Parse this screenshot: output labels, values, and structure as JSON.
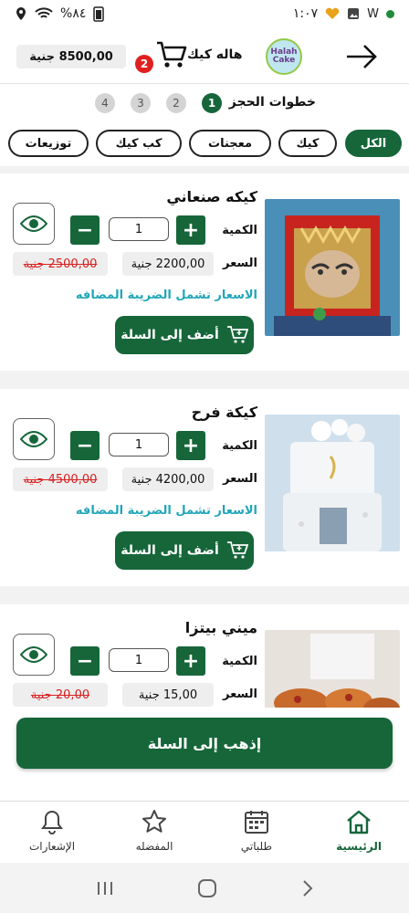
{
  "status_bar": {
    "time": "١:٠٧",
    "battery": "%٨٤"
  },
  "header": {
    "balance": "8500,00 جنية",
    "cart_count": "2",
    "shop_name": "هاله كيك",
    "logo_text": "Halah Cake"
  },
  "steps": {
    "label": "خطوات الحجز",
    "items": [
      "1",
      "2",
      "3",
      "4"
    ],
    "active": "1"
  },
  "categories": [
    {
      "label": "الكل",
      "active": true
    },
    {
      "label": "كيك"
    },
    {
      "label": "معجنات"
    },
    {
      "label": "كب كيك"
    },
    {
      "label": "توزيعات"
    }
  ],
  "labels": {
    "quantity": "الكمية",
    "price": "السعر",
    "tax_note": "الاسعار تشمل الضريبة المضافه",
    "add_to_cart": "أضف إلى السلة"
  },
  "products": [
    {
      "title": "كيكه صنعاني",
      "quantity": "1",
      "price": "2200,00 جنية",
      "old_price": "2500,00 جنية"
    },
    {
      "title": "كيكة فرح",
      "quantity": "1",
      "price": "4200,00 جنية",
      "old_price": "4500,00 جنية"
    },
    {
      "title": "ميني بيتزا",
      "quantity": "1",
      "price": "15,00 جنية",
      "old_price": "20,00 جنية"
    }
  ],
  "goto_cart": "إذهب إلى السلة",
  "bottom_nav": [
    {
      "label": "الرئيسية",
      "icon": "home-icon",
      "active": true
    },
    {
      "label": "طلباتي",
      "icon": "calendar-icon"
    },
    {
      "label": "المفضله",
      "icon": "star-icon"
    },
    {
      "label": "الإشعارات",
      "icon": "bell-icon"
    }
  ],
  "colors": {
    "primary": "#16663a",
    "badge": "#e02020",
    "tax_note": "#21a6b9",
    "old_price": "#d92020"
  }
}
